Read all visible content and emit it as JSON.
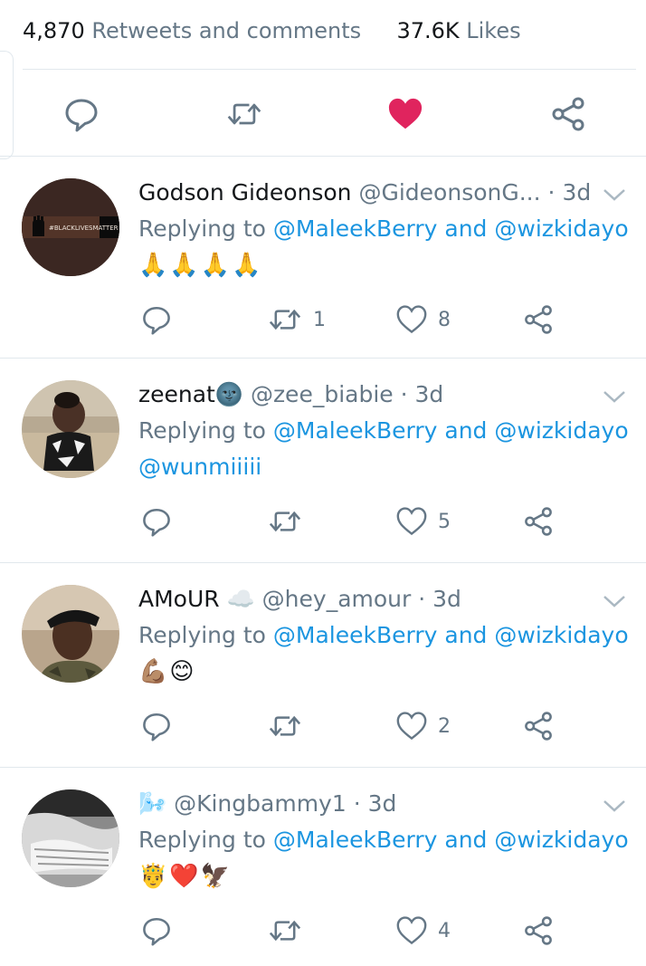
{
  "stats": {
    "retweets_count": "4,870",
    "retweets_label": "Retweets and comments",
    "likes_count": "37.6K",
    "likes_label": "Likes",
    "liked": true,
    "like_color": "#e0245e"
  },
  "colors": {
    "link": "#1b95e0",
    "muted": "#657786",
    "divider": "#e1e8ed"
  },
  "replies": [
    {
      "name": "Godson Gideonson",
      "handle": "@GideonsonG...",
      "time": "3d",
      "replying_prefix": "Replying to",
      "mention1": "@MaleekBerry",
      "and": "and",
      "mention2": "@wizkidayo",
      "text": "🙏🙏🙏🙏",
      "retweets": "1",
      "likes": "8",
      "avatar_text": "#BLACKLIVESMATTER"
    },
    {
      "name": "zeenat🌚",
      "handle": "@zee_biabie",
      "time": "3d",
      "replying_prefix": "Replying to",
      "mention1": "@MaleekBerry",
      "and": "and",
      "mention2": "@wizkidayo",
      "text": "@wunmiiiii",
      "retweets": "",
      "likes": "5"
    },
    {
      "name": "AMoUR ☁️",
      "handle": "@hey_amour",
      "time": "3d",
      "replying_prefix": "Replying to",
      "mention1": "@MaleekBerry",
      "and": "and",
      "mention2": "@wizkidayo",
      "text": "💪🏽😊",
      "retweets": "",
      "likes": "2"
    },
    {
      "name": "🌬️",
      "handle": "@Kingbammy1",
      "time": "3d",
      "replying_prefix": "Replying to",
      "mention1": "@MaleekBerry",
      "and": "and",
      "mention2": "@wizkidayo",
      "text": "🤴❤️🦅",
      "retweets": "",
      "likes": "4"
    }
  ]
}
